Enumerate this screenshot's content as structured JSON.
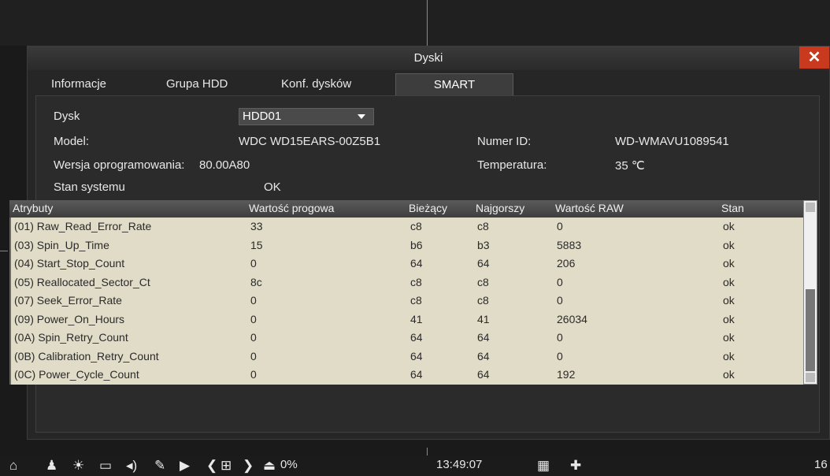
{
  "window": {
    "title": "Dyski",
    "close": "✕"
  },
  "tabs": [
    {
      "label": "Informacje"
    },
    {
      "label": "Grupa HDD"
    },
    {
      "label": "Konf. dysków"
    },
    {
      "label": "SMART"
    }
  ],
  "info": {
    "disk_label": "Dysk",
    "disk_value": "HDD01",
    "model_label": "Model:",
    "model_value": "WDC WD15EARS-00Z5B1",
    "id_label": "Numer ID:",
    "id_value": "WD-WMAVU1089541",
    "firmware_label": "Wersja oprogramowania:",
    "firmware_value": "80.00A80",
    "temp_label": "Temperatura:",
    "temp_value": "35 ℃",
    "status_label": "Stan systemu",
    "status_value": "OK"
  },
  "table": {
    "headers": [
      "Atrybuty",
      "Wartość progowa",
      "Bieżący",
      "Najgorszy",
      "Wartość RAW",
      "Stan"
    ],
    "rows": [
      [
        "(01) Raw_Read_Error_Rate",
        "33",
        "c8",
        "c8",
        "0",
        "ok"
      ],
      [
        "(03) Spin_Up_Time",
        "15",
        "b6",
        "b3",
        "5883",
        "ok"
      ],
      [
        "(04) Start_Stop_Count",
        "0",
        "64",
        "64",
        "206",
        "ok"
      ],
      [
        "(05) Reallocated_Sector_Ct",
        "8c",
        "c8",
        "c8",
        "0",
        "ok"
      ],
      [
        "(07) Seek_Error_Rate",
        "0",
        "c8",
        "c8",
        "0",
        "ok"
      ],
      [
        "(09) Power_On_Hours",
        "0",
        "41",
        "41",
        "26034",
        "ok"
      ],
      [
        "(0A) Spin_Retry_Count",
        "0",
        "64",
        "64",
        "0",
        "ok"
      ],
      [
        "(0B) Calibration_Retry_Count",
        "0",
        "64",
        "64",
        "0",
        "ok"
      ],
      [
        "(0C) Power_Cycle_Count",
        "0",
        "64",
        "64",
        "192",
        "ok"
      ]
    ]
  },
  "taskbar": {
    "icons": [
      "home-icon",
      "user-icon",
      "alarm-icon",
      "monitor-icon",
      "speaker-icon",
      "pen-icon",
      "play-icon",
      "prev-icon",
      "grid-icon",
      "next-icon",
      "hdd-icon",
      "qr-icon",
      "pin-icon"
    ],
    "hdd_usage": "0%",
    "time": "13:49:07",
    "right_num": "16"
  }
}
